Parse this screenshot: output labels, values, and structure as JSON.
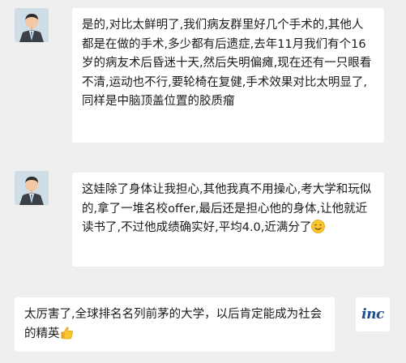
{
  "messages": [
    {
      "sender": "patient-parent",
      "avatar_icon": "person-avatar-icon",
      "text": "是的,对比太鲜明了,我们病友群里好几个手术的,其他人都是在做的手术,多少都有后遗症,去年11月我们有个16岁的病友术后昏迷十天,然后失明偏瘫,现在还有一只眼看不清,运动也不行,要轮椅在复健,手术效果对比太明显了,同样是中脑顶盖位置的胶质瘤"
    },
    {
      "sender": "patient-parent",
      "avatar_icon": "person-avatar-icon",
      "text": "这娃除了身体让我担心,其他我真不用操心,考大学和玩似的,拿了一堆名校offer,最后还是担心他的身体,让他就近读书了,不过他成绩确实好,平均4.0,近满分了",
      "emoji": "smiling-face-icon"
    },
    {
      "sender": "inc",
      "avatar_icon": "inc-logo",
      "avatar_text": "inc",
      "text": "太厉害了,全球排名名列前茅的大学，以后肯定能成为社会的精英",
      "emoji": "thumbs-up-icon"
    }
  ],
  "colors": {
    "background": "#efefef",
    "bubble": "#ffffff",
    "text": "#1b1b1b",
    "inc_brand": "#1c4f8c"
  }
}
